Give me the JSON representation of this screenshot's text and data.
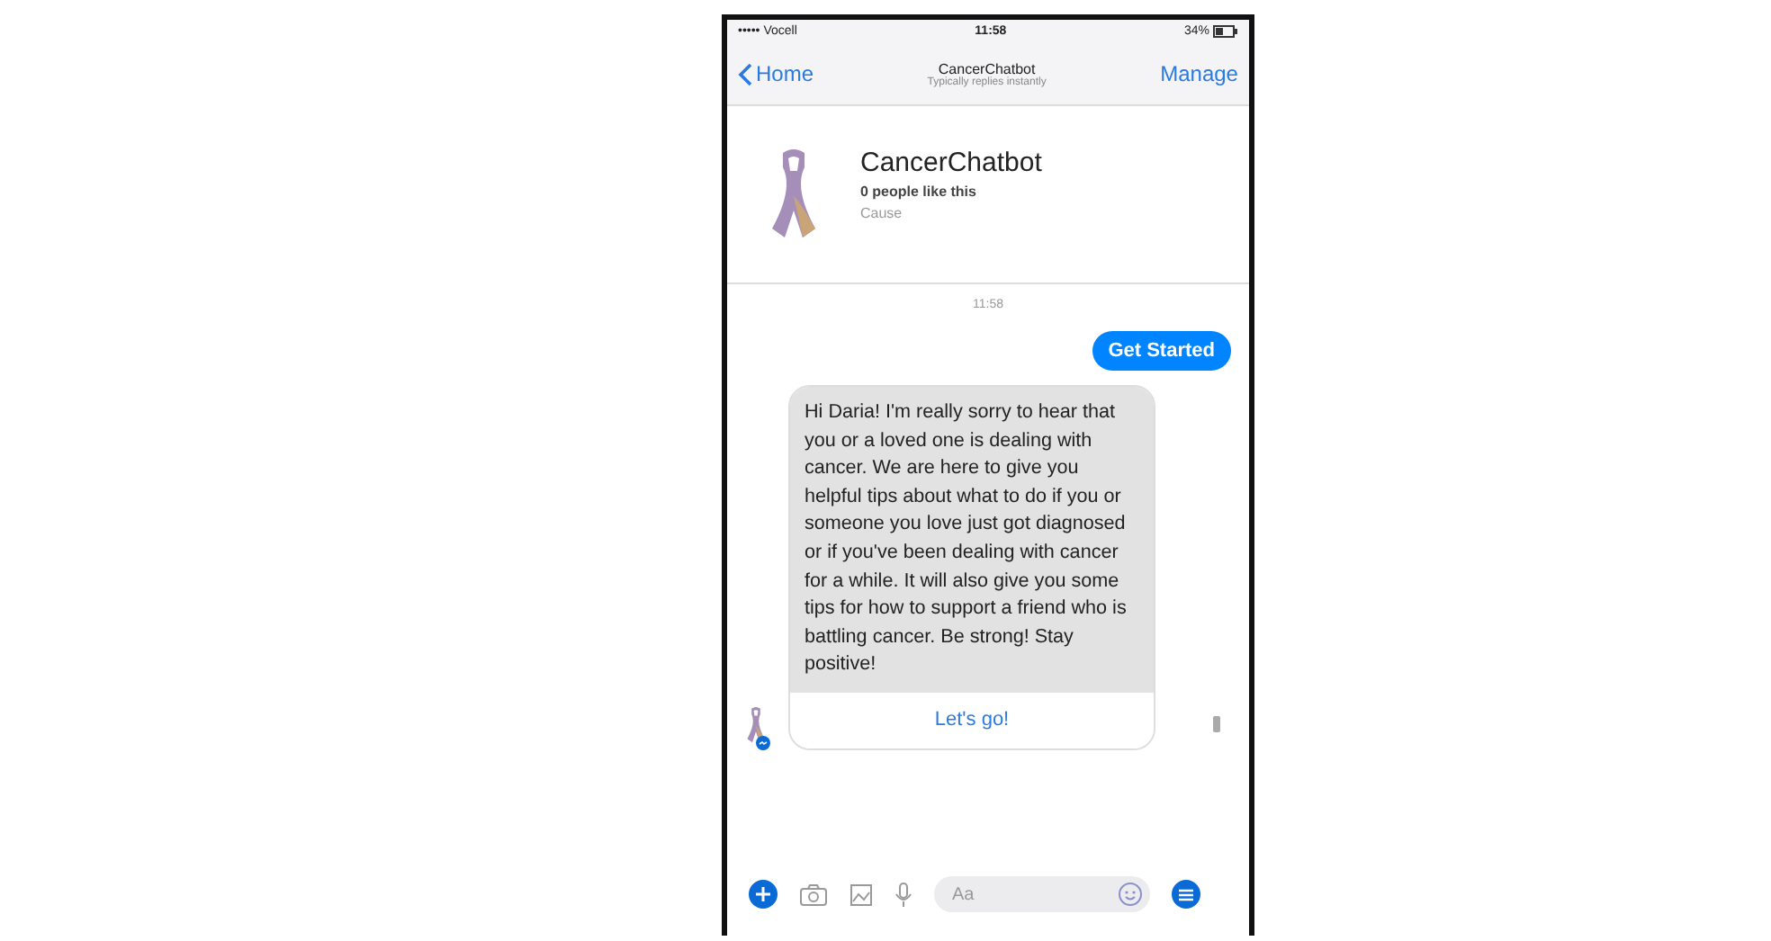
{
  "status_bar": {
    "carrier": "••••• Vocell",
    "time": "11:58",
    "battery": "34%"
  },
  "nav": {
    "back": "Home",
    "title": "CancerChatbot",
    "subtitle": "Typically replies instantly",
    "action": "Manage"
  },
  "profile": {
    "name": "CancerChatbot",
    "likes": "0 people like this",
    "category": "Cause"
  },
  "timestamp": "11:58",
  "messages": [
    {
      "kind": "outgoing",
      "text": "Get Started"
    },
    {
      "kind": "incoming",
      "text": "Hi Daria! I'm really sorry to hear that you or a loved one is dealing with cancer. We are here to give you helpful tips about what to do if you or someone you love just got diagnosed or if you've been dealing with cancer for a while. It will also give you some tips for how to support a friend who is battling cancer. Be strong! Stay positive!",
      "button": "Let's go!"
    }
  ],
  "composer": {
    "placeholder": "Aa"
  }
}
